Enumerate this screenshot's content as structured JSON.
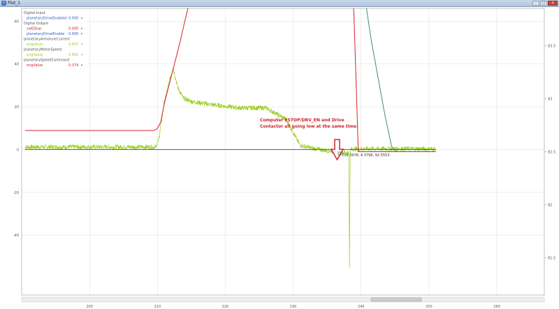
{
  "window": {
    "title": "Plot_1",
    "icon": "plot-app-icon",
    "controls": [
      "minimize",
      "maximize",
      "close"
    ]
  },
  "legend": [
    {
      "text": "Digital Input",
      "kind": "group"
    },
    {
      "text": "planetaryDriveEnabled",
      "value": "0.000",
      "color": "#1f5fc4",
      "kind": "signal"
    },
    {
      "text": "Digital Output",
      "kind": "group"
    },
    {
      "text": "swEStop",
      "value": "0.000",
      "color": "#d42027",
      "kind": "signal"
    },
    {
      "text": "planetaryDriveEnable",
      "value": "0.000",
      "color": "#1f5fc4",
      "kind": "signal"
    },
    {
      "text": "planetaryArmatureCurrent",
      "kind": "group"
    },
    {
      "text": "engValue",
      "value": "0.507",
      "color": "#9acd1a",
      "kind": "signal"
    },
    {
      "text": "planetaryMotorSpeed",
      "kind": "group"
    },
    {
      "text": "engValue",
      "value": "0.662",
      "color": "#9acd1a",
      "kind": "signal"
    },
    {
      "text": "planetarySpeedCommand",
      "kind": "group"
    },
    {
      "text": "engValue",
      "value": "0.374",
      "color": "#d42027",
      "kind": "signal"
    }
  ],
  "annotation": {
    "line1": "Computer ESTOP/DRV_EN and Drive",
    "line2": "Contactor all going low at the same time.",
    "color": "#d42027"
  },
  "cursor_readout": "238.3978, 4.3796, 92.5553",
  "chart_data": {
    "type": "line",
    "x_ticks": [
      "200",
      "210",
      "220",
      "230",
      "240",
      "250",
      "260"
    ],
    "xlim": [
      190,
      267
    ],
    "y_left_ticks": [
      "60",
      "40",
      "20",
      "0",
      "-20",
      "-40"
    ],
    "ylim_left": [
      -68,
      66
    ],
    "y_right_ticks": [
      "83.5",
      "83",
      "82.5",
      "82",
      "81.5"
    ],
    "ylim_right": [
      81.15,
      83.85
    ],
    "grid": true,
    "series": [
      {
        "name": "planetaryArmatureCurrent engValue",
        "color": "#9acd1a",
        "axis": "left",
        "x": [
          190.5,
          209.8,
          210.2,
          211.0,
          212.3,
          213.0,
          213.8,
          215,
          218,
          222,
          226,
          229,
          231,
          233,
          235,
          237,
          238.2,
          238.3,
          238.4,
          238.5,
          239.5,
          241,
          245,
          251
        ],
        "y": [
          1.2,
          1.2,
          5,
          22,
          38.5,
          29,
          24,
          22.5,
          21,
          19.5,
          19.5,
          14,
          2,
          0.5,
          -0.5,
          -1.2,
          -1.5,
          -55,
          -1.5,
          0.2,
          0.3,
          0.4,
          0.4,
          0.3
        ]
      },
      {
        "name": "planetaryMotorSpeed engValue",
        "color": "#3a8c7a",
        "axis": "right",
        "x": [
          240.8,
          241.5,
          242.5,
          243.5,
          244.5,
          245.2,
          251
        ],
        "y": [
          83.85,
          83.55,
          83.2,
          82.85,
          82.55,
          82.5,
          82.5
        ]
      },
      {
        "name": "planetarySpeedCommand engValue",
        "color": "#d42027",
        "axis": "right",
        "x": [
          190.5,
          209.5,
          210.0,
          210.5,
          211.0,
          211.6,
          212.2,
          212.8,
          213.4,
          214.0,
          214.5
        ],
        "y": [
          82.7,
          82.7,
          82.72,
          82.78,
          82.95,
          83.1,
          83.25,
          83.4,
          83.55,
          83.72,
          83.85
        ]
      },
      {
        "name": "swEStop",
        "color": "#d42027",
        "axis": "right",
        "x": [
          238.9,
          238.95,
          239.6,
          251
        ],
        "y": [
          83.85,
          83.8,
          82.5,
          82.5
        ]
      },
      {
        "name": "planetaryDriveEnabled",
        "color": "#1f5fc4",
        "axis": "left",
        "x": [
          190.5,
          251
        ],
        "y": [
          0,
          0
        ]
      }
    ]
  }
}
